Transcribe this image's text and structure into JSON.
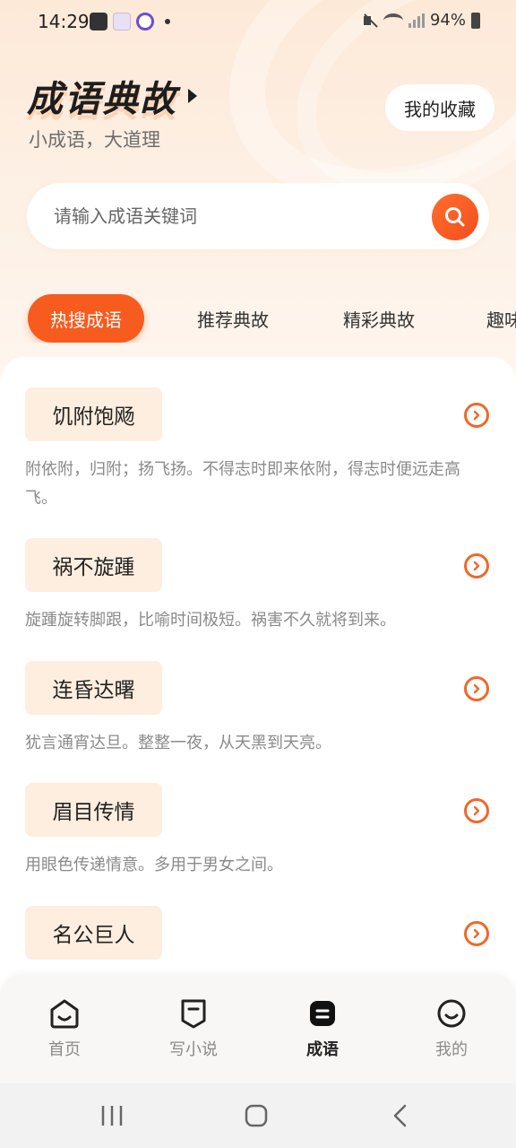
{
  "status_bar": {
    "time": "14:29",
    "battery": "94%"
  },
  "header": {
    "title": "成语典故",
    "subtitle": "小成语，大道理",
    "favorites_label": "我的收藏"
  },
  "search": {
    "placeholder": "请输入成语关键词"
  },
  "tabs": [
    {
      "label": "热搜成语",
      "active": true
    },
    {
      "label": "推荐典故",
      "active": false
    },
    {
      "label": "精彩典故",
      "active": false
    },
    {
      "label": "趣味",
      "active": false
    }
  ],
  "idioms": [
    {
      "name": "饥附饱飏",
      "desc": "附依附，归附；扬飞扬。不得志时即来依附，得志时便远走高飞。"
    },
    {
      "name": "祸不旋踵",
      "desc": "旋踵旋转脚跟，比喻时间极短。祸害不久就将到来。"
    },
    {
      "name": "连昏达曙",
      "desc": "犹言通宵达旦。整整一夜，从天黑到天亮。"
    },
    {
      "name": "眉目传情",
      "desc": "用眼色传递情意。多用于男女之间。"
    },
    {
      "name": "名公巨人",
      "desc": ""
    }
  ],
  "bottom_nav": [
    {
      "label": "首页",
      "icon": "home-icon",
      "active": false
    },
    {
      "label": "写小说",
      "icon": "write-novel-icon",
      "active": false
    },
    {
      "label": "成语",
      "icon": "idiom-icon",
      "active": true
    },
    {
      "label": "我的",
      "icon": "profile-icon",
      "active": false
    }
  ],
  "colors": {
    "accent": "#f85b1e",
    "chip_bg": "#fdeedf"
  }
}
